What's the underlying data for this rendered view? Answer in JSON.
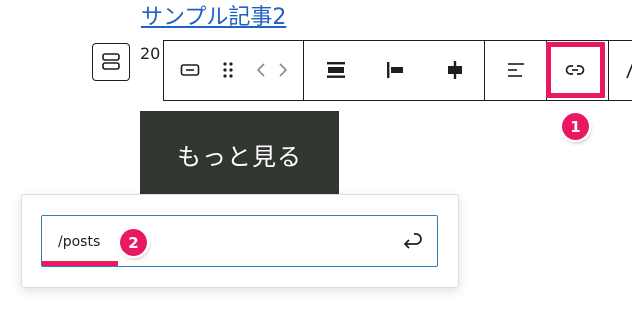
{
  "post": {
    "title": "サンプル記事2",
    "date_fragment": "20"
  },
  "toolbar": {
    "buttons": [
      {
        "name": "block-type",
        "icon": "button-block-icon"
      },
      {
        "name": "drag",
        "icon": "drag-handle-icon"
      },
      {
        "name": "move",
        "icon": "chevron-left-right-icon"
      },
      {
        "name": "align-top",
        "icon": "align-top-icon"
      },
      {
        "name": "align-left",
        "icon": "justify-left-icon"
      },
      {
        "name": "align-center",
        "icon": "justify-center-icon"
      },
      {
        "name": "text-align",
        "icon": "align-text-left-icon"
      },
      {
        "name": "link",
        "icon": "link-icon"
      }
    ]
  },
  "annotations": {
    "step1": "1",
    "step2": "2",
    "color": "#ea1862"
  },
  "more_button": {
    "label": "もっと見る",
    "background": "#323630"
  },
  "link_popover": {
    "url_value": "/posts",
    "submit_icon": "enter-return-icon"
  },
  "colors": {
    "link": "#2160c4",
    "focus_border": "#2b83b5"
  }
}
